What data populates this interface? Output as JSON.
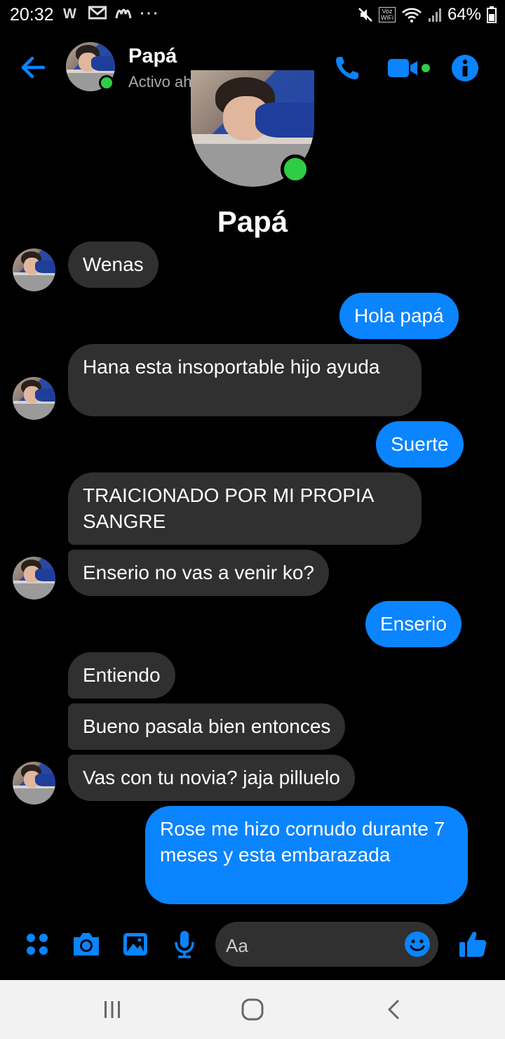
{
  "status_bar": {
    "time": "20:32",
    "notif_icons": "W",
    "battery": "64%",
    "voz_label": "Voz",
    "wifi_label": "WiFi"
  },
  "header": {
    "contact_name": "Papá",
    "contact_status": "Activo ahora",
    "accent_color": "#0a84ff",
    "online_color": "#31cc46"
  },
  "profile": {
    "name": "Papá"
  },
  "messages": [
    {
      "dir": "in",
      "text": "Wenas"
    },
    {
      "dir": "out",
      "text": "Hola papá"
    },
    {
      "dir": "in",
      "text": "Hana esta insoportable hijo ayuda"
    },
    {
      "dir": "out",
      "text": "Suerte"
    },
    {
      "dir": "in",
      "text": "TRAICIONADO POR MI PROPIA SANGRE"
    },
    {
      "dir": "in",
      "text": "Enserio no vas a venir ko?"
    },
    {
      "dir": "out",
      "text": "Enserio"
    },
    {
      "dir": "in",
      "text": "Entiendo"
    },
    {
      "dir": "in",
      "text": "Bueno pasala bien entonces"
    },
    {
      "dir": "in",
      "text": "Vas con tu novia? jaja pilluelo"
    },
    {
      "dir": "out",
      "text": "Rose me hizo cornudo durante 7 meses y esta embarazada"
    }
  ],
  "composer": {
    "placeholder": "Aa",
    "icons": [
      "menu-grid-icon",
      "camera-icon",
      "gallery-icon",
      "microphone-icon",
      "emoji-icon",
      "thumbs-up-icon"
    ]
  },
  "system_nav": {
    "icons": [
      "recents-icon",
      "home-icon",
      "back-icon"
    ]
  }
}
